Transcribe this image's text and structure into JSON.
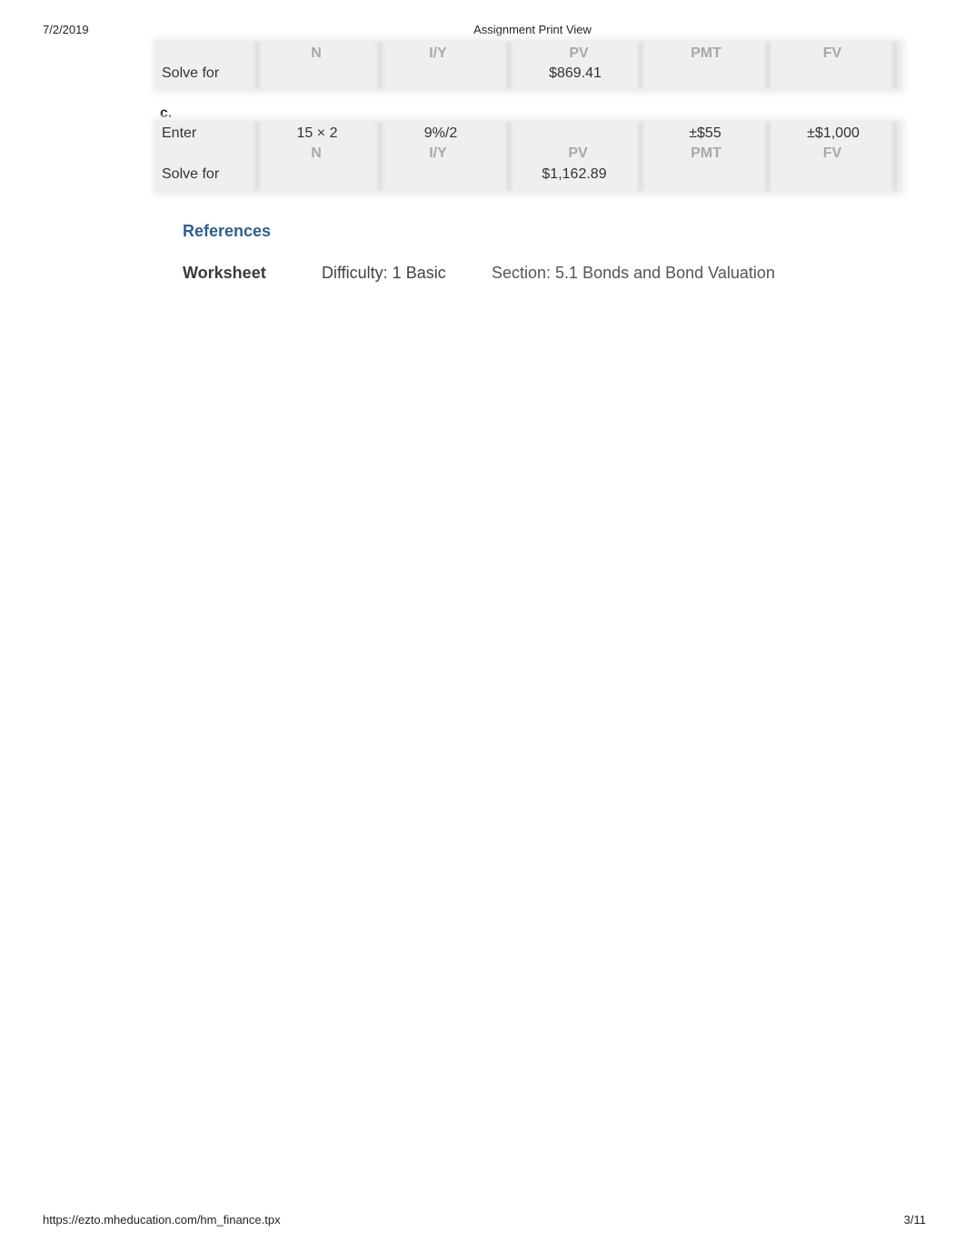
{
  "header": {
    "date": "7/2/2019",
    "title": "Assignment Print View"
  },
  "footer": {
    "url": "https://ezto.mheducation.com/hm_finance.tpx",
    "page": "3/11"
  },
  "calculator_keys": [
    "N",
    "I/Y",
    "PV",
    "PMT",
    "FV"
  ],
  "part_b": {
    "solve_label": "Solve for",
    "solve_values": {
      "N": "",
      "IY": "",
      "PV": "$869.41",
      "PMT": "",
      "FV": ""
    }
  },
  "part_c": {
    "label": "c.",
    "enter_label": "Enter",
    "enter_values": {
      "N": "15 × 2",
      "IY": "9%/2",
      "PV": "",
      "PMT": "±$55",
      "FV": "±$1,000"
    },
    "solve_label": "Solve for",
    "solve_values": {
      "N": "",
      "IY": "",
      "PV": "$1,162.89",
      "PMT": "",
      "FV": ""
    }
  },
  "references": {
    "heading": "References",
    "type": "Worksheet",
    "difficulty": "Difficulty: 1 Basic",
    "section": "Section: 5.1 Bonds and Bond Valuation"
  }
}
